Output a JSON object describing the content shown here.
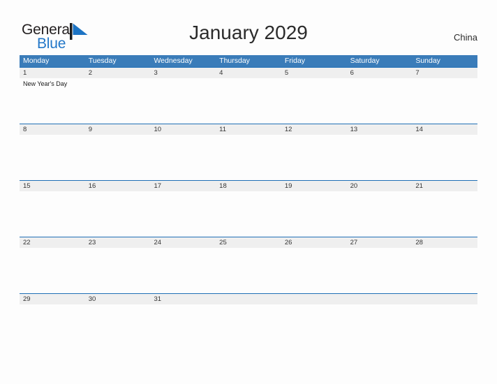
{
  "logo": {
    "word_one": "General",
    "word_two": "Blue",
    "flag_icon": "blue-flag-triangle",
    "color_dark": "#231f20",
    "color_blue": "#2277c8"
  },
  "header": {
    "title": "January 2029",
    "region": "China"
  },
  "theme": {
    "header_blue": "#3a7cb9",
    "rule_blue": "#1f6fb5",
    "date_band_gray": "#efefef",
    "page_background": "#fdfdfd",
    "text_dark": "#2b2b2b"
  },
  "calendar": {
    "month": "January",
    "year": "2029",
    "day_names": [
      "Monday",
      "Tuesday",
      "Wednesday",
      "Thursday",
      "Friday",
      "Saturday",
      "Sunday"
    ],
    "weeks": [
      {
        "days": [
          {
            "date": "1",
            "events": [
              "New Year's Day"
            ]
          },
          {
            "date": "2",
            "events": []
          },
          {
            "date": "3",
            "events": []
          },
          {
            "date": "4",
            "events": []
          },
          {
            "date": "5",
            "events": []
          },
          {
            "date": "6",
            "events": []
          },
          {
            "date": "7",
            "events": []
          }
        ]
      },
      {
        "days": [
          {
            "date": "8",
            "events": []
          },
          {
            "date": "9",
            "events": []
          },
          {
            "date": "10",
            "events": []
          },
          {
            "date": "11",
            "events": []
          },
          {
            "date": "12",
            "events": []
          },
          {
            "date": "13",
            "events": []
          },
          {
            "date": "14",
            "events": []
          }
        ]
      },
      {
        "days": [
          {
            "date": "15",
            "events": []
          },
          {
            "date": "16",
            "events": []
          },
          {
            "date": "17",
            "events": []
          },
          {
            "date": "18",
            "events": []
          },
          {
            "date": "19",
            "events": []
          },
          {
            "date": "20",
            "events": []
          },
          {
            "date": "21",
            "events": []
          }
        ]
      },
      {
        "days": [
          {
            "date": "22",
            "events": []
          },
          {
            "date": "23",
            "events": []
          },
          {
            "date": "24",
            "events": []
          },
          {
            "date": "25",
            "events": []
          },
          {
            "date": "26",
            "events": []
          },
          {
            "date": "27",
            "events": []
          },
          {
            "date": "28",
            "events": []
          }
        ]
      },
      {
        "days": [
          {
            "date": "29",
            "events": []
          },
          {
            "date": "30",
            "events": []
          },
          {
            "date": "31",
            "events": []
          },
          {
            "date": "",
            "events": []
          },
          {
            "date": "",
            "events": []
          },
          {
            "date": "",
            "events": []
          },
          {
            "date": "",
            "events": []
          }
        ]
      }
    ]
  }
}
